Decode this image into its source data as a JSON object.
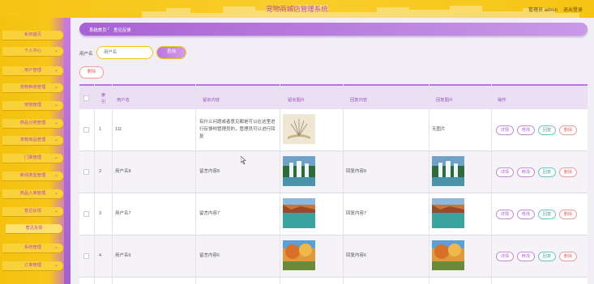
{
  "header": {
    "title": "宠物商城店管理系统",
    "user": "管理员 admin",
    "logout": "退出登录"
  },
  "sidebar": {
    "items": [
      {
        "label": "系统首页",
        "chevron": false
      },
      {
        "label": "个人中心",
        "chevron": true
      },
      {
        "label": "用户管理",
        "chevron": true
      },
      {
        "label": "宠物种类管理",
        "chevron": true
      },
      {
        "label": "宠物管理",
        "chevron": true
      },
      {
        "label": "商品分类管理",
        "chevron": true
      },
      {
        "label": "宠物商品管理",
        "chevron": true
      },
      {
        "label": "门票管理",
        "chevron": true
      },
      {
        "label": "新闻类型管理",
        "chevron": true
      },
      {
        "label": "商品入库管理",
        "chevron": true
      },
      {
        "label": "意见反馈",
        "chevron": true
      },
      {
        "label": "意见反馈",
        "chevron": false,
        "sub": true
      },
      {
        "label": "系统管理",
        "chevron": true
      },
      {
        "label": "订单管理",
        "chevron": true
      }
    ]
  },
  "breadcrumb": {
    "home": "系统首页",
    "sep": "/",
    "current": "意见反馈"
  },
  "search": {
    "label": "用户名",
    "placeholder": "用户名",
    "button": "查询"
  },
  "actions": {
    "delete": "删除"
  },
  "table": {
    "headers": {
      "index": "索引",
      "username": "用户名",
      "content": "留言内容",
      "image": "留言图片",
      "reply": "回复内容",
      "reply_image": "回复图片",
      "ops": "操作"
    },
    "ops": {
      "detail": "详情",
      "edit": "修改",
      "reply": "回复",
      "delete": "删除"
    },
    "rows": [
      {
        "index": "1",
        "username": "111",
        "content": "有什么问题或者意见都是可以在这里进行反馈哟管理员的，管理员可以进行回复",
        "image": "book",
        "reply": "",
        "reply_image_text": "无图片"
      },
      {
        "index": "2",
        "username": "用户名8",
        "content": "留言内容8",
        "image": "waterfall",
        "reply": "回复内容8",
        "reply_image": "waterfall"
      },
      {
        "index": "3",
        "username": "用户名7",
        "content": "留言内容7",
        "image": "lake",
        "reply": "回复内容7",
        "reply_image": "lake"
      },
      {
        "index": "4",
        "username": "用户名6",
        "content": "留言内容6",
        "image": "autumn",
        "reply": "回复内容6",
        "reply_image": "autumn"
      }
    ]
  },
  "colors": {
    "header": "#f6c514",
    "accent_purple": "#a862d3",
    "header_text": "#b84db6"
  }
}
